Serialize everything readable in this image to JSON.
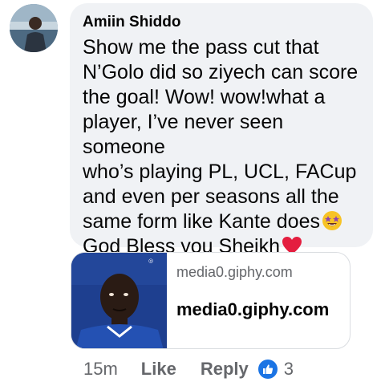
{
  "comment": {
    "author": "Amiin Shiddo",
    "text": "Show me the pass cut that\nN’Golo did so ziyech can score\nthe goal! Wow! wow!what a\nplayer, I’ve never seen someone\nwho’s playing PL, UCL, FACup\nand even per seasons all the\nsame form like Kante does",
    "text_line2": "God Bless you Sheikh",
    "emojis": [
      "star-struck-icon",
      "red-heart-icon"
    ]
  },
  "link_preview": {
    "domain_small": "media0.giphy.com",
    "domain_title": "media0.giphy.com"
  },
  "actions": {
    "time": "15m",
    "like_label": "Like",
    "reply_label": "Reply",
    "reaction_icon": "like-icon",
    "reaction_count": "3"
  },
  "colors": {
    "bubble_bg": "#f0f2f5",
    "secondary_text": "#65676b",
    "like_blue": "#1b74e4",
    "heart_red": "#e41e3f",
    "jersey_blue": "#1e3f8f"
  }
}
